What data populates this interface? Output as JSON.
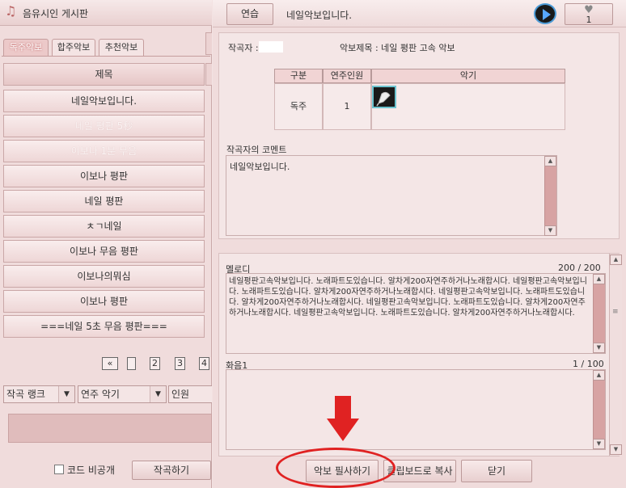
{
  "window": {
    "title": "음유시인 게시판"
  },
  "tabs": [
    "독주악보",
    "합주악보",
    "추천악보"
  ],
  "list": {
    "header": "제목",
    "items": [
      {
        "label": "네일악보입니다.",
        "faded": false
      },
      {
        "label": "네일 평판 5秒",
        "faded": true
      },
      {
        "label": "이보나 1분 무음",
        "faded": true
      },
      {
        "label": "이보나 평판",
        "faded": false
      },
      {
        "label": "네일 평판",
        "faded": false
      },
      {
        "label": "ㅊㄱ네일",
        "faded": false
      },
      {
        "label": "이보나 무음 평판",
        "faded": false
      },
      {
        "label": "이보나의뭐심",
        "faded": false
      },
      {
        "label": "이보나 평판",
        "faded": false
      },
      {
        "label": "===네일 5초 무음 평판===",
        "faded": false
      }
    ]
  },
  "pagination": {
    "prev_icon": "double-left-arrow-icon",
    "pages": [
      "",
      "2",
      "3",
      "4"
    ]
  },
  "filters": {
    "rank": "작곡 랭크",
    "instrument": "연주 악기",
    "players": "인원"
  },
  "footer_left": {
    "private_label": "코드 비공개",
    "compose_label": "작곡하기"
  },
  "topbar": {
    "practice_label": "연습",
    "sheet_name": "네일악보입니다.",
    "like_count": "1"
  },
  "info": {
    "composer_label": "작곡자 :",
    "sheet_title_label": "악보제목 : 네일 평판 고속 악보",
    "table": {
      "headers": [
        "구분",
        "연주인원",
        "악기"
      ],
      "row": {
        "type": "독주",
        "players": "1",
        "instrument_icon": "quill-pen-icon"
      }
    },
    "comment_label": "작곡자의 코멘트",
    "comment_text": "네일악보입니다."
  },
  "melody": {
    "label": "멜로디",
    "count": "200 / 200",
    "text": "네일평판고속악보입니다. 노래파트도있습니다. 알차게200자연주하거나노래합시다. 네일평판고속악보입니다. 노래파트도있습니다. 알차게200자연주하거나노래합시다. 네일평판고속악보입니다. 노래파트도있습니다. 알차게200자연주하거나노래합시다. 네일평판고속악보입니다. 노래파트도있습니다. 알차게200자연주하거나노래합시다. 네일평판고속악보입니다. 노래파트도있습니다. 알차게200자연주하거나노래합시다."
  },
  "chord1": {
    "label": "화음1",
    "count": "1 / 100"
  },
  "footer_right": {
    "copy_sheet_label": "악보 필사하기",
    "clipboard_label": "클립보드로 복사",
    "close_label": "닫기"
  },
  "colors": {
    "accent_annotation": "#e02222",
    "panel_bg": "#f0dcdc"
  }
}
